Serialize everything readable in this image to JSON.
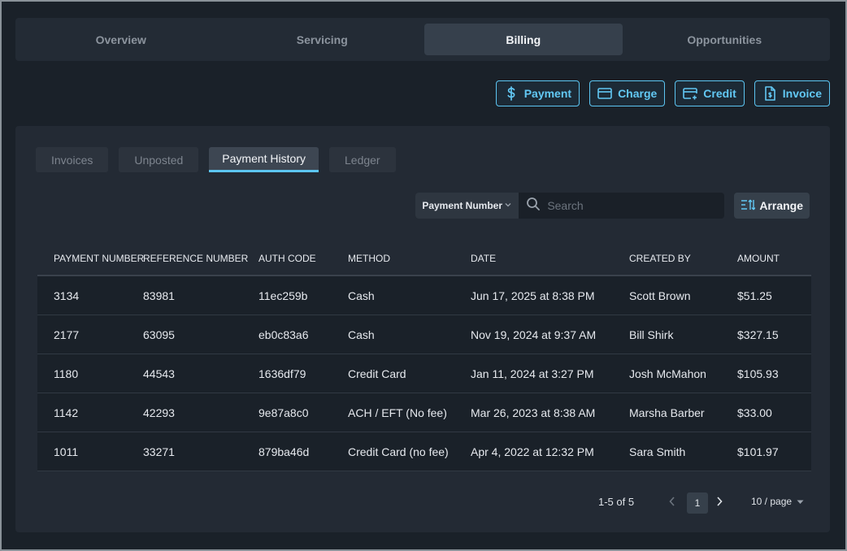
{
  "top_tabs": [
    {
      "label": "Overview"
    },
    {
      "label": "Servicing"
    },
    {
      "label": "Billing"
    },
    {
      "label": "Opportunities"
    }
  ],
  "actions": {
    "payment": "Payment",
    "charge": "Charge",
    "credit": "Credit",
    "invoice": "Invoice"
  },
  "sub_tabs": [
    {
      "label": "Invoices"
    },
    {
      "label": "Unposted"
    },
    {
      "label": "Payment History"
    },
    {
      "label": "Ledger"
    }
  ],
  "search": {
    "field_selected": "Payment Number",
    "placeholder": "Search"
  },
  "arrange_label": "Arrange",
  "table": {
    "headers": [
      "PAYMENT NUMBER",
      "REFERENCE NUMBER",
      "AUTH CODE",
      "METHOD",
      "DATE",
      "CREATED BY",
      "AMOUNT"
    ],
    "rows": [
      [
        "3134",
        "83981",
        "11ec259b",
        "Cash",
        "Jun 17, 2025 at 8:38 PM",
        "Scott  Brown",
        "$51.25"
      ],
      [
        "2177",
        "63095",
        "eb0c83a6",
        "Cash",
        "Nov 19, 2024 at 9:37 AM",
        "Bill  Shirk",
        "$327.15"
      ],
      [
        "1180",
        "44543",
        "1636df79",
        "Credit Card",
        "Jan 11, 2024 at 3:27 PM",
        "Josh  McMahon",
        "$105.93"
      ],
      [
        "1142",
        "42293",
        "9e87a8c0",
        "ACH / EFT (No fee)",
        "Mar 26, 2023 at 8:38 AM",
        "Marsha  Barber",
        "$33.00"
      ],
      [
        "1011",
        "33271",
        "879ba46d",
        "Credit Card (no fee)",
        "Apr 4, 2022 at 12:32 PM",
        "Sara  Smith",
        "$101.97"
      ]
    ]
  },
  "pagination": {
    "range": "1-5 of 5",
    "page": "1",
    "page_size": "10 / page"
  },
  "colors": {
    "accent": "#5cc5f2",
    "background": "#1a2129",
    "panel": "#232a34"
  }
}
